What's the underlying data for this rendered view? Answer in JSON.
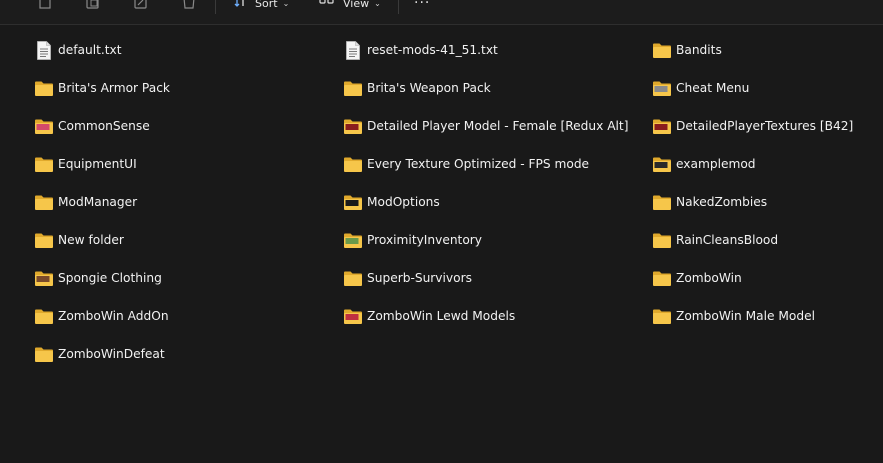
{
  "toolbar": {
    "sort_label": "Sort",
    "view_label": "View",
    "more_label": "···"
  },
  "items": [
    {
      "name": "default.txt",
      "type": "text-file-icon",
      "thumb": ""
    },
    {
      "name": "reset-mods-41_51.txt",
      "type": "text-file-icon",
      "thumb": ""
    },
    {
      "name": "Bandits",
      "type": "folder-icon",
      "thumb": ""
    },
    {
      "name": "Brita's Armor Pack",
      "type": "folder-icon",
      "thumb": ""
    },
    {
      "name": "Brita's Weapon Pack",
      "type": "folder-icon",
      "thumb": ""
    },
    {
      "name": "Cheat Menu",
      "type": "folder-icon",
      "thumb": "#8a8a8a"
    },
    {
      "name": "CommonSense",
      "type": "folder-icon",
      "thumb": "#d44a6a"
    },
    {
      "name": "Detailed Player Model - Female [Redux Alt]",
      "type": "folder-icon",
      "thumb": "#8a1d1d"
    },
    {
      "name": "DetailedPlayerTextures [B42]",
      "type": "folder-icon",
      "thumb": "#8a1d1d"
    },
    {
      "name": "EquipmentUI",
      "type": "folder-icon",
      "thumb": ""
    },
    {
      "name": "Every Texture Optimized - FPS mode",
      "type": "folder-icon",
      "thumb": ""
    },
    {
      "name": "examplemod",
      "type": "folder-icon",
      "thumb": "#2a2a2a"
    },
    {
      "name": "ModManager",
      "type": "folder-icon",
      "thumb": ""
    },
    {
      "name": "ModOptions",
      "type": "folder-icon",
      "thumb": "#1a1a1a"
    },
    {
      "name": "NakedZombies",
      "type": "folder-icon",
      "thumb": ""
    },
    {
      "name": "New folder",
      "type": "folder-icon",
      "thumb": ""
    },
    {
      "name": "ProximityInventory",
      "type": "folder-icon",
      "thumb": "#6a9a4a"
    },
    {
      "name": "RainCleansBlood",
      "type": "folder-icon",
      "thumb": ""
    },
    {
      "name": "Spongie Clothing",
      "type": "folder-icon",
      "thumb": "#7a4a2a"
    },
    {
      "name": "Superb-Survivors",
      "type": "folder-icon",
      "thumb": ""
    },
    {
      "name": "ZomboWin",
      "type": "folder-icon",
      "thumb": ""
    },
    {
      "name": "ZomboWin AddOn",
      "type": "folder-icon",
      "thumb": ""
    },
    {
      "name": "ZomboWin Lewd Models",
      "type": "folder-icon",
      "thumb": "#c03040"
    },
    {
      "name": "ZomboWin Male Model",
      "type": "folder-icon",
      "thumb": ""
    },
    {
      "name": "ZomboWinDefeat",
      "type": "folder-icon",
      "thumb": ""
    }
  ],
  "colors": {
    "background": "#191919",
    "folder": "#f6c64a",
    "folder_dark": "#e0a92c",
    "text": "#f2f2f2"
  }
}
